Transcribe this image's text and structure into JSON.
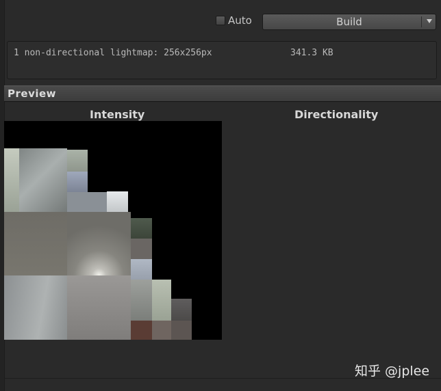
{
  "toolbar": {
    "auto_label": "Auto",
    "auto_checked": false,
    "build_label": "Build"
  },
  "info": {
    "description": "1 non-directional lightmap: 256x256px",
    "size": "341.3 KB"
  },
  "preview": {
    "title": "Preview",
    "intensity_label": "Intensity",
    "directionality_label": "Directionality"
  },
  "watermark": "知乎 @jplee",
  "colors": {
    "panel_bg": "#2a2a2a",
    "header_bg": "#424242",
    "lightmap_bg": "#000000"
  }
}
